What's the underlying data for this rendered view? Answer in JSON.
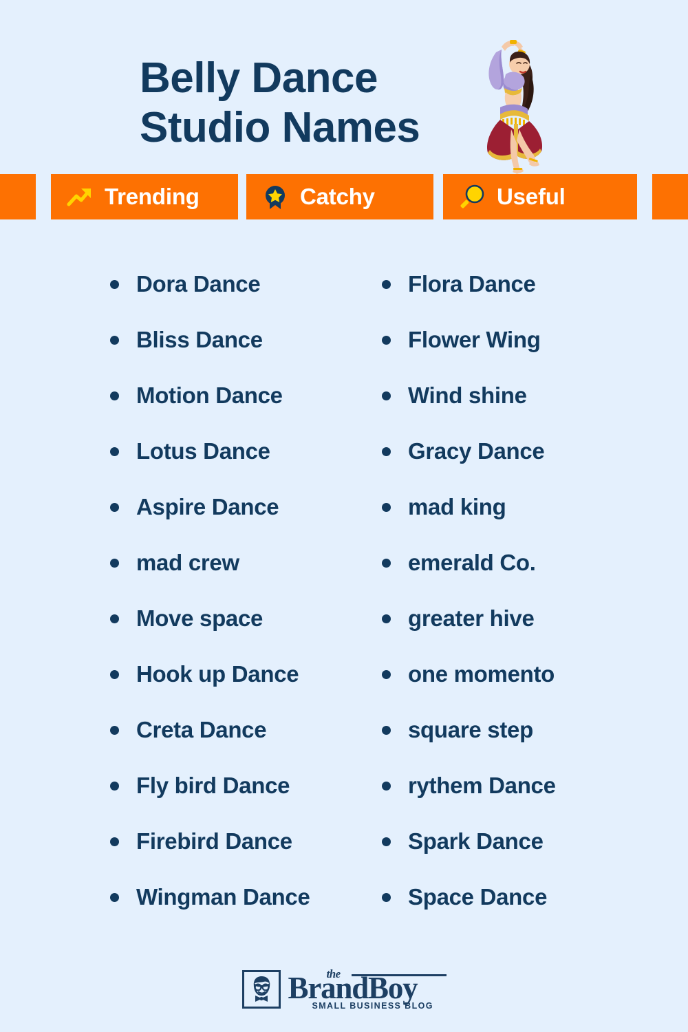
{
  "header": {
    "title_line1": "Belly Dance",
    "title_line2": "Studio Names",
    "illustration": "belly-dancer-illustration"
  },
  "badges": [
    {
      "label": "Trending",
      "icon": "trending-up-icon"
    },
    {
      "label": "Catchy",
      "icon": "award-star-icon"
    },
    {
      "label": "Useful",
      "icon": "magnifying-glass-icon"
    }
  ],
  "lists": {
    "left": [
      "Dora Dance",
      "Bliss Dance",
      "Motion Dance",
      "Lotus Dance",
      "Aspire Dance",
      "mad crew",
      "Move space",
      "Hook up Dance",
      "Creta Dance",
      "Fly bird Dance",
      "Firebird Dance",
      "Wingman Dance"
    ],
    "right": [
      "Flora Dance",
      "Flower Wing",
      "Wind shine",
      "Gracy Dance",
      "mad king",
      "emerald Co.",
      "greater hive",
      "one momento",
      "square step",
      "rythem Dance",
      "Spark Dance",
      "Space Dance"
    ]
  },
  "footer": {
    "logo_the": "the",
    "logo_name": "BrandBoy",
    "logo_tagline": "SMALL BUSINESS BLOG",
    "logo_mark": "boy-face-icon"
  },
  "colors": {
    "background": "#e4f0fd",
    "navy": "#123a5e",
    "orange": "#fd7102",
    "yellow": "#ffd400",
    "white": "#ffffff"
  }
}
